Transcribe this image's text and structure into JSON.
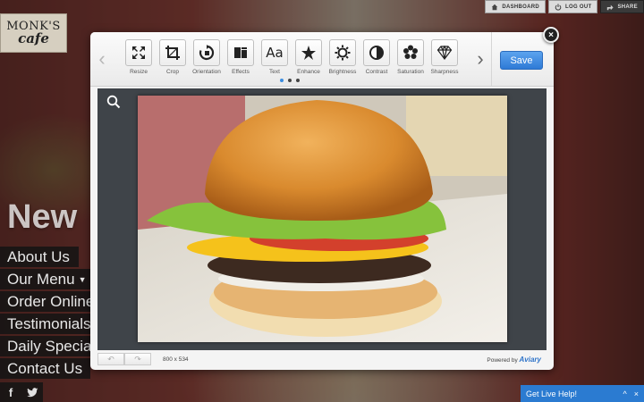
{
  "site": {
    "logo": {
      "line1": "MONK'S",
      "line2": "cafe"
    },
    "topbar": [
      {
        "label": "DASHBOARD",
        "icon": "home-icon"
      },
      {
        "label": "LOG OUT",
        "icon": "power-icon"
      },
      {
        "label": "SHARE",
        "icon": "share-icon"
      }
    ],
    "hero_word": "New",
    "nav": [
      "About Us",
      "Our Menu",
      "Order Online",
      "Testimonials",
      "Daily Specials",
      "Contact Us"
    ],
    "social": [
      "f",
      "t"
    ],
    "live_help": {
      "label": "Get Live Help!",
      "controls": [
        "^",
        "×"
      ]
    }
  },
  "editor": {
    "tools": [
      {
        "label": "Resize",
        "icon": "resize-icon"
      },
      {
        "label": "Crop",
        "icon": "crop-icon"
      },
      {
        "label": "Orientation",
        "icon": "orientation-icon"
      },
      {
        "label": "Effects",
        "icon": "effects-icon"
      },
      {
        "label": "Text",
        "icon": "text-icon",
        "glyph": "Aa"
      },
      {
        "label": "Enhance",
        "icon": "enhance-icon"
      },
      {
        "label": "Brightness",
        "icon": "brightness-icon"
      },
      {
        "label": "Contrast",
        "icon": "contrast-icon"
      },
      {
        "label": "Saturation",
        "icon": "saturation-icon"
      },
      {
        "label": "Sharpness",
        "icon": "sharpness-icon"
      }
    ],
    "pager": {
      "pages": 3,
      "active": 1
    },
    "save_label": "Save",
    "image_dims": "800 x 534",
    "powered_by": "Powered by",
    "brand": "Aviary",
    "close_glyph": "×"
  },
  "colors": {
    "accent": "#2e7ad6",
    "live_help_bg": "#2b7bd1",
    "canvas_bg": "#3f4449"
  }
}
